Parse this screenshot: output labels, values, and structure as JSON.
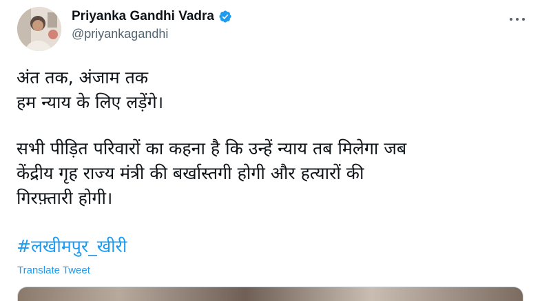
{
  "author": {
    "display_name": "Priyanka Gandhi Vadra",
    "handle": "@priyankagandhi",
    "verified": true
  },
  "icons": {
    "avatar": "profile-photo",
    "verified": "verified-badge-icon",
    "more": "more-options-icon"
  },
  "tweet": {
    "paragraph1": [
      "अंत तक, अंजाम तक",
      "हम न्याय के लिए लड़ेंगे।"
    ],
    "paragraph2": [
      "सभी पीड़ित परिवारों का कहना है कि उन्हें न्याय तब मिलेगा जब",
      "केंद्रीय गृह राज्य मंत्री की बर्खास्तगी होगी और हत्यारों की",
      "गिरफ़्तारी होगी।"
    ],
    "hashtag": "#लखीमपुर_खीरी",
    "translate_label": "Translate Tweet"
  },
  "colors": {
    "link": "#1d9bf0",
    "secondary_text": "#536471",
    "primary_text": "#0f1419",
    "verified_badge": "#1d9bf0"
  }
}
